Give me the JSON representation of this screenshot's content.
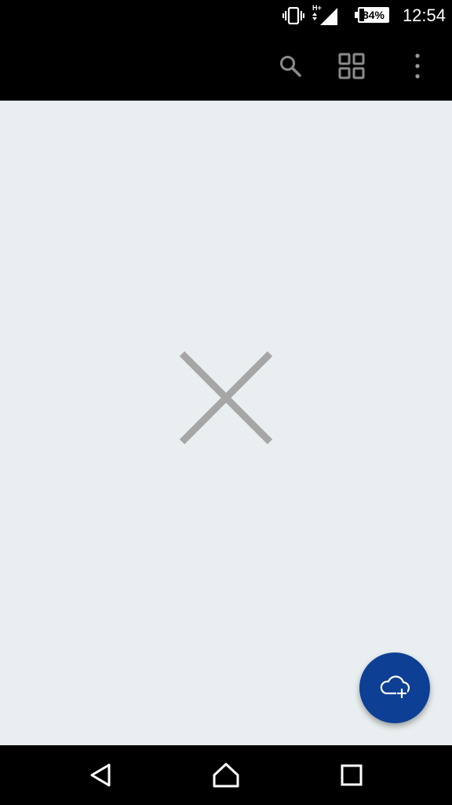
{
  "status_bar": {
    "battery_percent": "84%",
    "time": "12:54",
    "network_type": "H+",
    "icons": [
      "vibrate-icon",
      "signal-icon",
      "battery-icon"
    ]
  },
  "app_bar": {
    "actions": [
      {
        "icon": "search-icon"
      },
      {
        "icon": "grid-view-icon"
      },
      {
        "icon": "more-vert-icon"
      }
    ]
  },
  "content": {
    "state_icon": "close-icon",
    "fab_icon": "cloud-add-icon"
  },
  "nav_bar": {
    "buttons": [
      {
        "icon": "back-icon"
      },
      {
        "icon": "home-icon"
      },
      {
        "icon": "recents-icon"
      }
    ]
  },
  "colors": {
    "content_bg": "#e9eff0",
    "fab_bg": "#0d3f94",
    "icon_gray": "#a6a6a6",
    "bar_bg": "#000000"
  }
}
